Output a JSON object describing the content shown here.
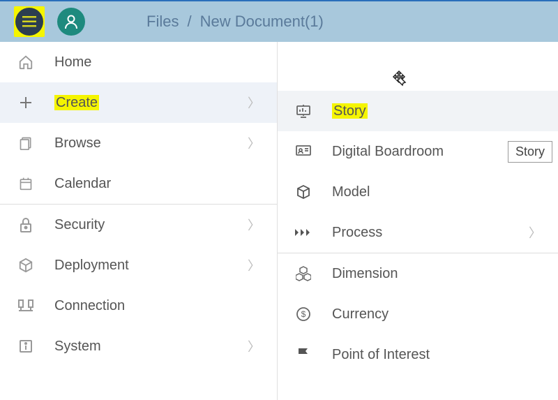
{
  "header": {
    "breadcrumb": {
      "root": "Files",
      "separator": "/",
      "current": "New Document(1)"
    }
  },
  "sidebar": {
    "items": [
      {
        "label": "Home",
        "icon": "home-icon",
        "hasSubmenu": false
      },
      {
        "label": "Create",
        "icon": "plus-icon",
        "hasSubmenu": true,
        "active": true,
        "highlighted": true
      },
      {
        "label": "Browse",
        "icon": "browse-icon",
        "hasSubmenu": true
      },
      {
        "label": "Calendar",
        "icon": "calendar-icon",
        "hasSubmenu": false
      },
      {
        "label": "Security",
        "icon": "lock-icon",
        "hasSubmenu": true
      },
      {
        "label": "Deployment",
        "icon": "box-icon",
        "hasSubmenu": true
      },
      {
        "label": "Connection",
        "icon": "connection-icon",
        "hasSubmenu": false
      },
      {
        "label": "System",
        "icon": "info-icon",
        "hasSubmenu": true
      }
    ]
  },
  "submenu": {
    "items": [
      {
        "label": "Story",
        "icon": "presentation-icon",
        "active": true,
        "highlighted": true
      },
      {
        "label": "Digital Boardroom",
        "icon": "screen-icon",
        "tooltip": "Story"
      },
      {
        "label": "Model",
        "icon": "cube-icon"
      },
      {
        "label": "Process",
        "icon": "process-icon",
        "hasSubmenu": true
      },
      {
        "label": "Dimension",
        "icon": "cubes-icon"
      },
      {
        "label": "Currency",
        "icon": "currency-icon"
      },
      {
        "label": "Point of Interest",
        "icon": "flag-icon"
      }
    ]
  }
}
